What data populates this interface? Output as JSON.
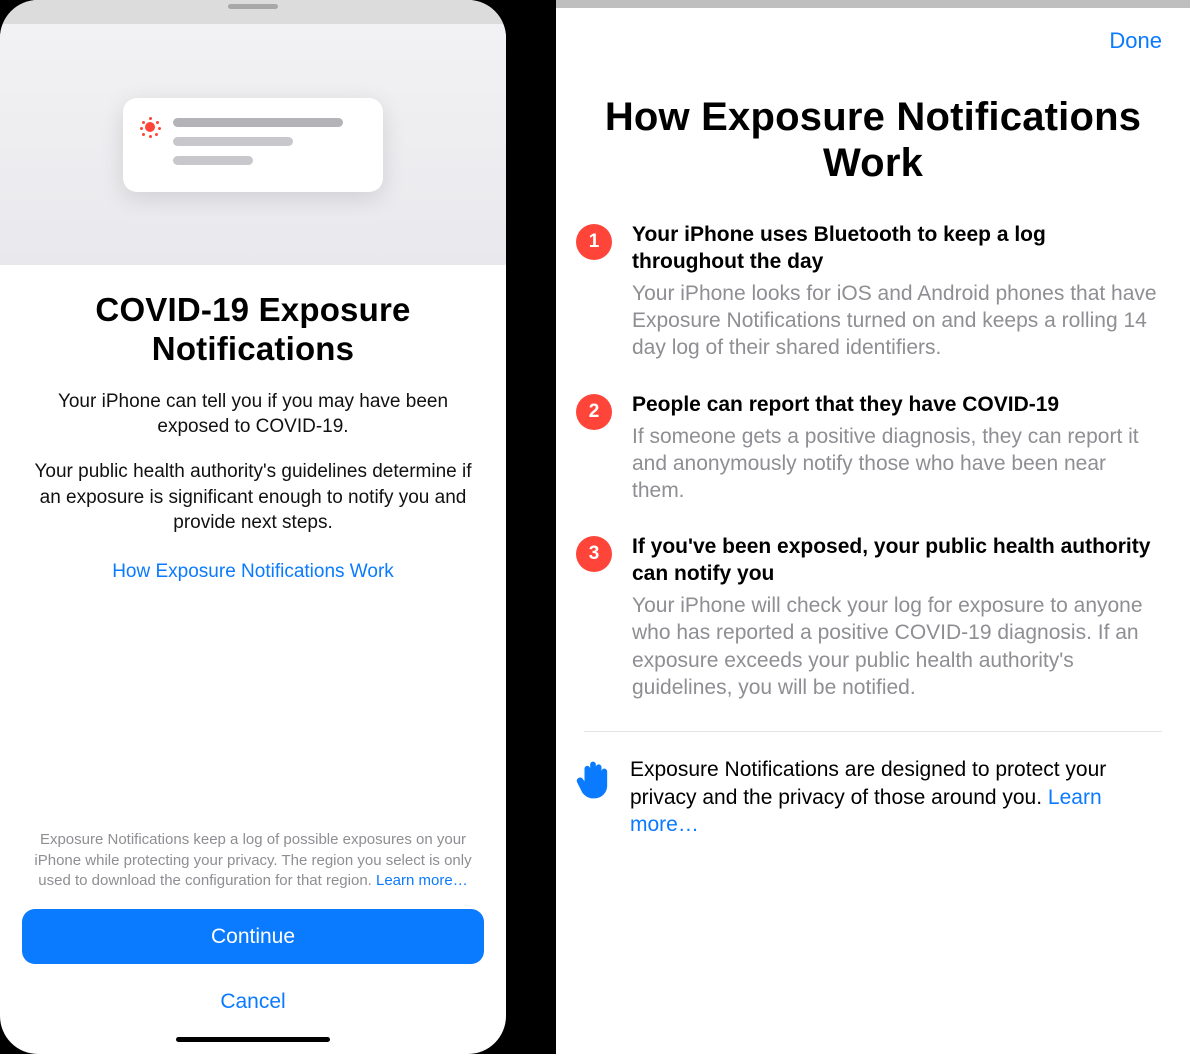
{
  "colors": {
    "accent": "#0a7aff",
    "danger": "#ff453a",
    "secondaryText": "#8e8e93"
  },
  "left": {
    "title": "COVID-19 Exposure Notifications",
    "desc1": "Your iPhone can tell you if you may have been exposed to COVID-19.",
    "desc2": "Your public health authority's guidelines determine if an exposure is significant enough to notify you and provide next steps.",
    "howLink": "How Exposure Notifications Work",
    "finePrint": "Exposure Notifications keep a log of possible exposures on your iPhone while protecting your privacy. The region you select is only used to download the configuration for that region. ",
    "learnMore": "Learn more…",
    "continue": "Continue",
    "cancel": "Cancel"
  },
  "right": {
    "done": "Done",
    "title": "How Exposure Notifications Work",
    "steps": [
      {
        "n": "1",
        "title": "Your iPhone uses Bluetooth to keep a log throughout the day",
        "desc": "Your iPhone looks for iOS and Android phones that have Exposure Notifications turned on and keeps a rolling 14 day log of their shared identifiers."
      },
      {
        "n": "2",
        "title": "People can report that they have COVID-19",
        "desc": "If someone gets a positive diagnosis, they can report it and anonymously notify those who have been near them."
      },
      {
        "n": "3",
        "title": "If you've been exposed, your public health authority can notify you",
        "desc": "Your iPhone will check your log for exposure to anyone who has reported a positive COVID-19 diagnosis. If an exposure exceeds your public health authority's guidelines, you will be notified."
      }
    ],
    "privacy": "Exposure Notifications are designed to protect your privacy and the privacy of those around you. ",
    "learnMore": "Learn more…"
  }
}
